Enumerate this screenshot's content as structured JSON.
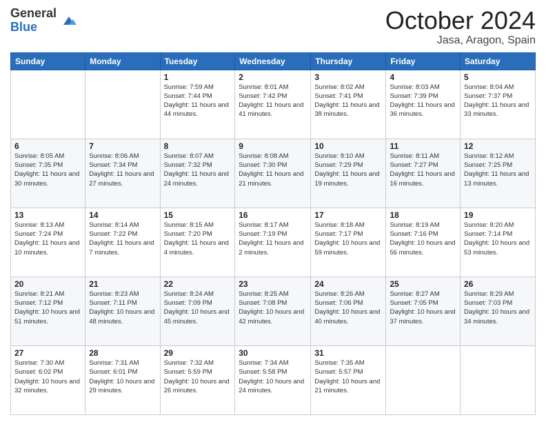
{
  "logo": {
    "general": "General",
    "blue": "Blue"
  },
  "header": {
    "month": "October 2024",
    "location": "Jasa, Aragon, Spain"
  },
  "weekdays": [
    "Sunday",
    "Monday",
    "Tuesday",
    "Wednesday",
    "Thursday",
    "Friday",
    "Saturday"
  ],
  "weeks": [
    [
      {
        "day": "",
        "info": ""
      },
      {
        "day": "",
        "info": ""
      },
      {
        "day": "1",
        "info": "Sunrise: 7:59 AM\nSunset: 7:44 PM\nDaylight: 11 hours and 44 minutes."
      },
      {
        "day": "2",
        "info": "Sunrise: 8:01 AM\nSunset: 7:42 PM\nDaylight: 11 hours and 41 minutes."
      },
      {
        "day": "3",
        "info": "Sunrise: 8:02 AM\nSunset: 7:41 PM\nDaylight: 11 hours and 38 minutes."
      },
      {
        "day": "4",
        "info": "Sunrise: 8:03 AM\nSunset: 7:39 PM\nDaylight: 11 hours and 36 minutes."
      },
      {
        "day": "5",
        "info": "Sunrise: 8:04 AM\nSunset: 7:37 PM\nDaylight: 11 hours and 33 minutes."
      }
    ],
    [
      {
        "day": "6",
        "info": "Sunrise: 8:05 AM\nSunset: 7:35 PM\nDaylight: 11 hours and 30 minutes."
      },
      {
        "day": "7",
        "info": "Sunrise: 8:06 AM\nSunset: 7:34 PM\nDaylight: 11 hours and 27 minutes."
      },
      {
        "day": "8",
        "info": "Sunrise: 8:07 AM\nSunset: 7:32 PM\nDaylight: 11 hours and 24 minutes."
      },
      {
        "day": "9",
        "info": "Sunrise: 8:08 AM\nSunset: 7:30 PM\nDaylight: 11 hours and 21 minutes."
      },
      {
        "day": "10",
        "info": "Sunrise: 8:10 AM\nSunset: 7:29 PM\nDaylight: 11 hours and 19 minutes."
      },
      {
        "day": "11",
        "info": "Sunrise: 8:11 AM\nSunset: 7:27 PM\nDaylight: 11 hours and 16 minutes."
      },
      {
        "day": "12",
        "info": "Sunrise: 8:12 AM\nSunset: 7:25 PM\nDaylight: 11 hours and 13 minutes."
      }
    ],
    [
      {
        "day": "13",
        "info": "Sunrise: 8:13 AM\nSunset: 7:24 PM\nDaylight: 11 hours and 10 minutes."
      },
      {
        "day": "14",
        "info": "Sunrise: 8:14 AM\nSunset: 7:22 PM\nDaylight: 11 hours and 7 minutes."
      },
      {
        "day": "15",
        "info": "Sunrise: 8:15 AM\nSunset: 7:20 PM\nDaylight: 11 hours and 4 minutes."
      },
      {
        "day": "16",
        "info": "Sunrise: 8:17 AM\nSunset: 7:19 PM\nDaylight: 11 hours and 2 minutes."
      },
      {
        "day": "17",
        "info": "Sunrise: 8:18 AM\nSunset: 7:17 PM\nDaylight: 10 hours and 59 minutes."
      },
      {
        "day": "18",
        "info": "Sunrise: 8:19 AM\nSunset: 7:16 PM\nDaylight: 10 hours and 56 minutes."
      },
      {
        "day": "19",
        "info": "Sunrise: 8:20 AM\nSunset: 7:14 PM\nDaylight: 10 hours and 53 minutes."
      }
    ],
    [
      {
        "day": "20",
        "info": "Sunrise: 8:21 AM\nSunset: 7:12 PM\nDaylight: 10 hours and 51 minutes."
      },
      {
        "day": "21",
        "info": "Sunrise: 8:23 AM\nSunset: 7:11 PM\nDaylight: 10 hours and 48 minutes."
      },
      {
        "day": "22",
        "info": "Sunrise: 8:24 AM\nSunset: 7:09 PM\nDaylight: 10 hours and 45 minutes."
      },
      {
        "day": "23",
        "info": "Sunrise: 8:25 AM\nSunset: 7:08 PM\nDaylight: 10 hours and 42 minutes."
      },
      {
        "day": "24",
        "info": "Sunrise: 8:26 AM\nSunset: 7:06 PM\nDaylight: 10 hours and 40 minutes."
      },
      {
        "day": "25",
        "info": "Sunrise: 8:27 AM\nSunset: 7:05 PM\nDaylight: 10 hours and 37 minutes."
      },
      {
        "day": "26",
        "info": "Sunrise: 8:29 AM\nSunset: 7:03 PM\nDaylight: 10 hours and 34 minutes."
      }
    ],
    [
      {
        "day": "27",
        "info": "Sunrise: 7:30 AM\nSunset: 6:02 PM\nDaylight: 10 hours and 32 minutes."
      },
      {
        "day": "28",
        "info": "Sunrise: 7:31 AM\nSunset: 6:01 PM\nDaylight: 10 hours and 29 minutes."
      },
      {
        "day": "29",
        "info": "Sunrise: 7:32 AM\nSunset: 5:59 PM\nDaylight: 10 hours and 26 minutes."
      },
      {
        "day": "30",
        "info": "Sunrise: 7:34 AM\nSunset: 5:58 PM\nDaylight: 10 hours and 24 minutes."
      },
      {
        "day": "31",
        "info": "Sunrise: 7:35 AM\nSunset: 5:57 PM\nDaylight: 10 hours and 21 minutes."
      },
      {
        "day": "",
        "info": ""
      },
      {
        "day": "",
        "info": ""
      }
    ]
  ]
}
